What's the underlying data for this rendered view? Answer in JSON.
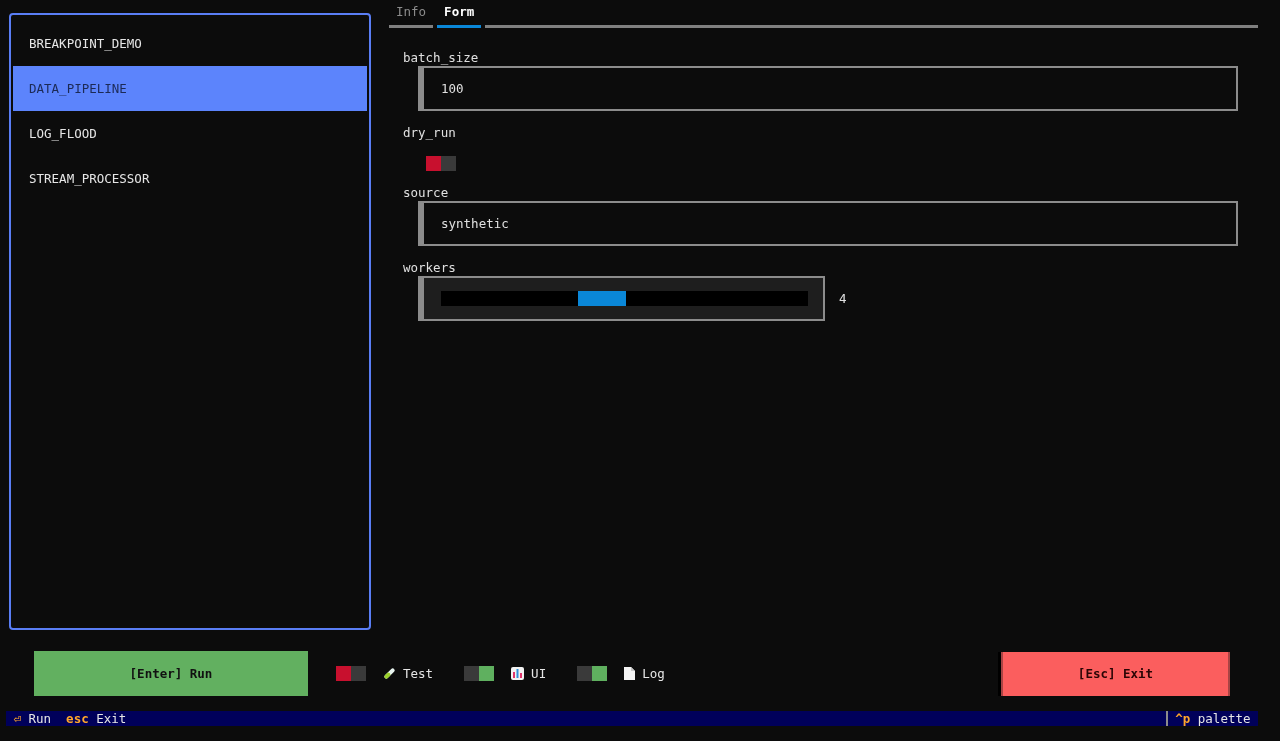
{
  "sidebar": {
    "items": [
      {
        "label": "BREAKPOINT_DEMO",
        "selected": false
      },
      {
        "label": "DATA_PIPELINE",
        "selected": true
      },
      {
        "label": "LOG_FLOOD",
        "selected": false
      },
      {
        "label": "STREAM_PROCESSOR",
        "selected": false
      }
    ]
  },
  "tabs": [
    {
      "label": "Info",
      "selected": false
    },
    {
      "label": "Form",
      "selected": true
    }
  ],
  "form": {
    "fields": [
      {
        "kind": "input",
        "label": "batch_size",
        "value": "100"
      },
      {
        "kind": "switch",
        "label": "dry_run",
        "on": false
      },
      {
        "kind": "input",
        "label": "source",
        "value": "synthetic"
      },
      {
        "kind": "slider",
        "label": "workers",
        "level": 0.43,
        "reading": "4"
      }
    ]
  },
  "actions": {
    "run_button": "[Enter] Run",
    "toggles": [
      {
        "label": "Test",
        "on": false
      },
      {
        "label": "UI",
        "on": true
      },
      {
        "label": "Log",
        "on": true
      }
    ],
    "exit_button": "[Esc] Exit"
  },
  "footer": {
    "bindings": [
      {
        "key": "⏎",
        "label": "Run"
      },
      {
        "key": "esc",
        "label": "Exit"
      }
    ],
    "palette": {
      "key": "^p",
      "label": "palette"
    }
  }
}
